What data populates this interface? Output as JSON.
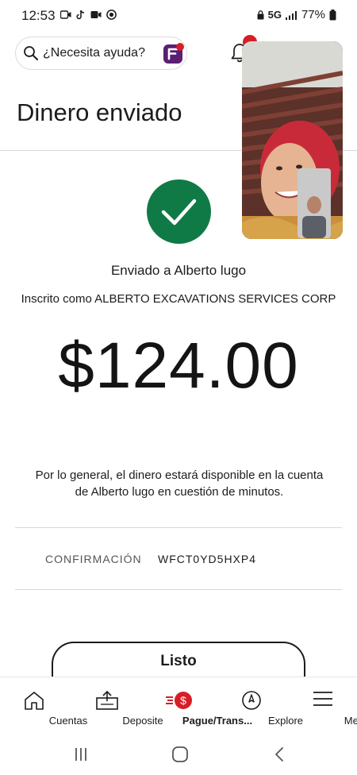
{
  "status_bar": {
    "time": "12:53",
    "network": "5G",
    "battery": "77%"
  },
  "search": {
    "label": "¿Necesita ayuda?"
  },
  "header": {
    "title": "Dinero enviado"
  },
  "confirmation_screen": {
    "sent_to": "Enviado a Alberto lugo",
    "registered_as": "Inscrito como ALBERTO EXCAVATIONS SERVICES CORP",
    "amount": "$124.00",
    "availability_line1": "Por lo general, el dinero estará disponible en la cuenta",
    "availability_line2": "de Alberto lugo en cuestión de minutos.",
    "confirmation_label": "CONFIRMACIÓN",
    "confirmation_number": "WFCT0YD5HXP4",
    "done_label": "Listo"
  },
  "bottom_nav": {
    "items": [
      {
        "label": "Cuentas",
        "icon": "home-icon"
      },
      {
        "label": "Deposite",
        "icon": "deposit-icon"
      },
      {
        "label": "Pague/Trans...",
        "icon": "pay-transfer-icon"
      },
      {
        "label": "Explore",
        "icon": "compass-icon"
      },
      {
        "label": "Menú",
        "icon": "menu-icon"
      }
    ]
  },
  "colors": {
    "brand_red": "#d71e28",
    "success_green": "#0f7a45",
    "assistant_purple": "#5a1f73"
  }
}
